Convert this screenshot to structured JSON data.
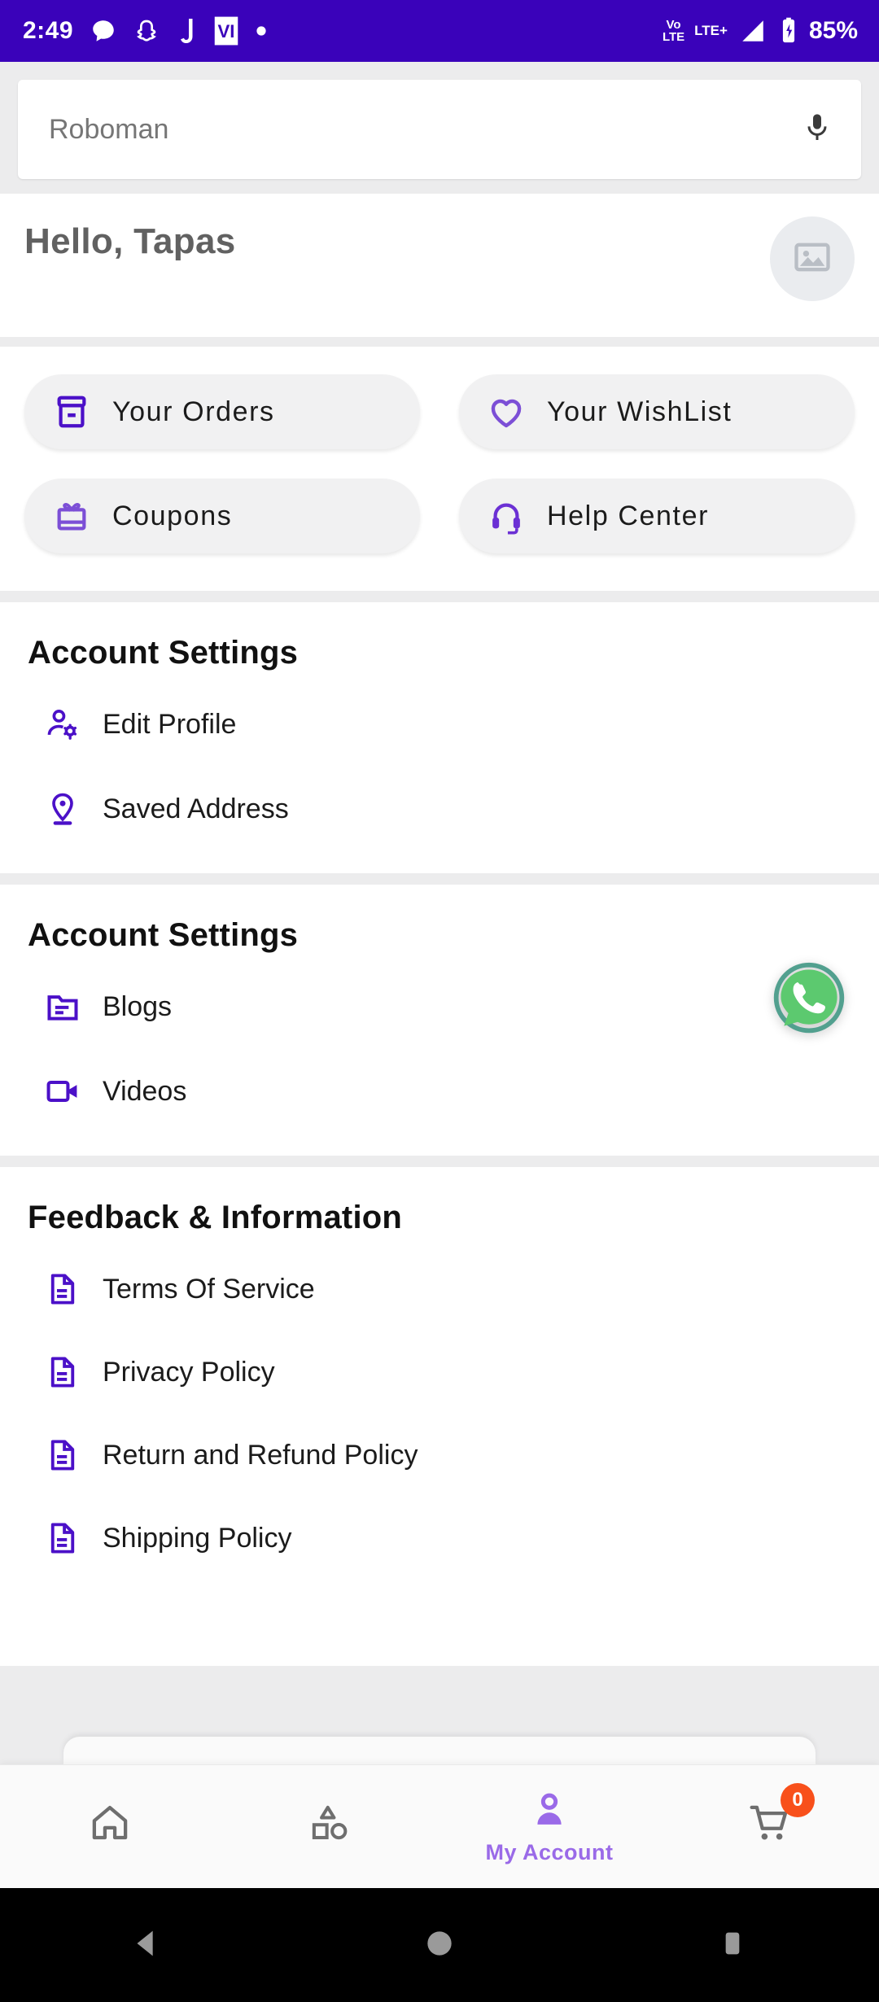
{
  "statusbar": {
    "time": "2:49",
    "notification_icons": [
      "chat-bubble-icon",
      "snapchat-ghost-icon",
      "letter-j-icon",
      "vi-app-icon",
      "dot-icon"
    ],
    "volte_line1": "Vo",
    "volte_line2": "LTE",
    "network": "LTE+",
    "battery_percent": "85%",
    "background_color": "#3a02ba"
  },
  "search": {
    "placeholder": "Roboman",
    "mic_icon": "microphone-icon"
  },
  "greeting": {
    "text": "Hello, Tapas",
    "avatar_icon": "image-placeholder-icon"
  },
  "quick_actions": [
    {
      "label": "Your Orders",
      "icon": "archive-box-icon",
      "color": "#4b10c8"
    },
    {
      "label": "Your WishList",
      "icon": "heart-icon",
      "color": "#7c4fd6"
    },
    {
      "label": "Coupons",
      "icon": "gift-icon",
      "color": "#7c4fd6"
    },
    {
      "label": "Help Center",
      "icon": "headset-icon",
      "color": "#6b30d4"
    }
  ],
  "sections": [
    {
      "title": "Account Settings",
      "items": [
        {
          "label": "Edit Profile",
          "icon": "user-gear-icon"
        },
        {
          "label": "Saved Address",
          "icon": "map-pin-icon"
        }
      ]
    },
    {
      "title": "Account Settings",
      "items": [
        {
          "label": "Blogs",
          "icon": "folder-document-icon"
        },
        {
          "label": "Videos",
          "icon": "video-camera-icon"
        }
      ]
    },
    {
      "title": "Feedback & Information",
      "items": [
        {
          "label": "Terms Of Service",
          "icon": "document-icon"
        },
        {
          "label": "Privacy Policy",
          "icon": "document-icon"
        },
        {
          "label": "Return and Refund Policy",
          "icon": "document-icon"
        },
        {
          "label": "Shipping Policy",
          "icon": "document-icon"
        }
      ]
    }
  ],
  "whatsapp_fab": {
    "icon": "whatsapp-icon",
    "color": "#5cc96f"
  },
  "bottom_nav": {
    "items": [
      {
        "name": "home",
        "icon": "home-icon",
        "label": "",
        "active": false
      },
      {
        "name": "categories",
        "icon": "shapes-icon",
        "label": "",
        "active": false
      },
      {
        "name": "my-account",
        "icon": "person-icon",
        "label": "My Account",
        "active": true
      },
      {
        "name": "cart",
        "icon": "shopping-cart-icon",
        "label": "",
        "active": false,
        "badge": "0"
      }
    ],
    "active_color": "#9a6ae8",
    "inactive_color": "#6e6e6e",
    "badge_color": "#f8501b"
  },
  "android_nav": {
    "back_icon": "triangle-back-icon",
    "home_icon": "circle-home-icon",
    "recents_icon": "square-recents-icon"
  },
  "theme": {
    "primary_purple": "#4b10c8",
    "status_purple": "#3a02ba",
    "page_bg": "#ececed"
  }
}
